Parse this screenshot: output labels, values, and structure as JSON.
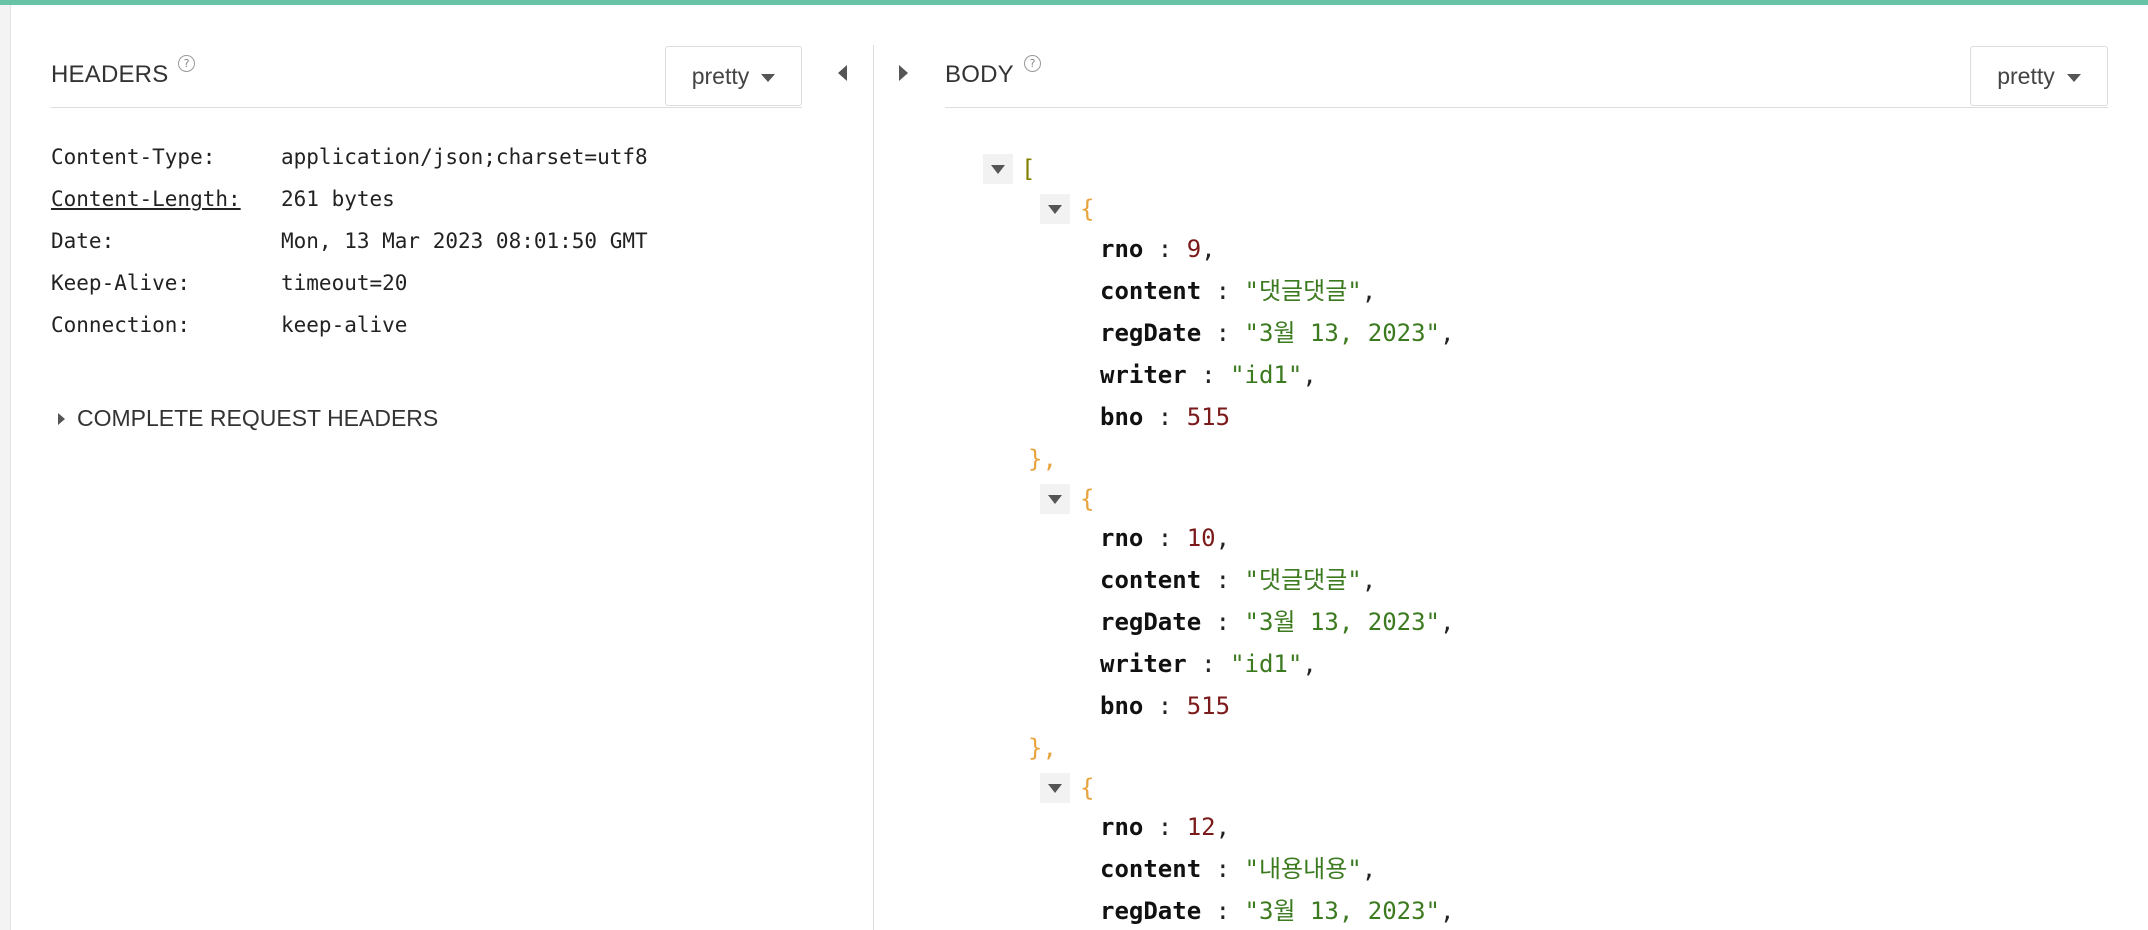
{
  "headers_panel": {
    "title": "HEADERS",
    "help_glyph": "?",
    "format_label": "pretty",
    "rows": [
      {
        "name": "Content-Type:",
        "value": "application/json;charset=utf8"
      },
      {
        "name": "Content-Length:",
        "value": "261 bytes"
      },
      {
        "name": "Date:",
        "value": "Mon, 13 Mar 2023 08:01:50 GMT"
      },
      {
        "name": "Keep-Alive:",
        "value": "timeout=20"
      },
      {
        "name": "Connection:",
        "value": "keep-alive"
      }
    ],
    "complete_headers_label": "COMPLETE REQUEST HEADERS"
  },
  "body_panel": {
    "title": "BODY",
    "help_glyph": "?",
    "format_label": "pretty",
    "open_bracket": "[",
    "open_brace": "{",
    "close_brace": "},",
    "key_sep": " :  ",
    "comma": ",",
    "items": [
      {
        "rno": "9",
        "content": "\"댓글댓글\"",
        "regDate": "\"3월 13, 2023\"",
        "writer": "\"id1\"",
        "bno": "515"
      },
      {
        "rno": "10",
        "content": "\"댓글댓글\"",
        "regDate": "\"3월 13, 2023\"",
        "writer": "\"id1\"",
        "bno": "515"
      },
      {
        "rno": "12",
        "content": "\"내용내용\"",
        "regDate": "\"3월 13, 2023\""
      }
    ],
    "keys": {
      "rno": "rno",
      "content": "content",
      "regDate": "regDate",
      "writer": "writer",
      "bno": "bno"
    }
  },
  "colors": {
    "accent": "#67c2a6",
    "json_key": "#111111",
    "json_number": "#7a1a1a",
    "json_string": "#3c7a20",
    "json_brace": "#e8a33d",
    "json_bracket": "#808000"
  },
  "icons": {
    "collapse_left": "triangle-left-icon",
    "expand_right": "triangle-right-icon",
    "dropdown": "caret-down-icon",
    "help": "help-circle-icon",
    "node_toggle": "caret-down-icon"
  }
}
